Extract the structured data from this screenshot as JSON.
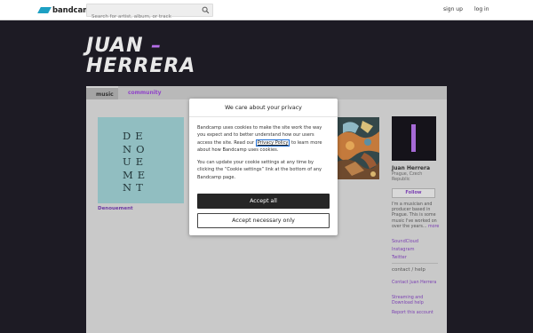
{
  "header": {
    "brand": "bandcamp",
    "search_placeholder": "Search for artist, album, or track",
    "signup_label": "sign up",
    "login_label": "log in",
    "brand_color": "#1da0c3"
  },
  "artist": {
    "name_line1": "JUAN",
    "name_dash": "–",
    "name_line2": "HERRERA",
    "accent_color": "#b56ee8"
  },
  "tabs": [
    {
      "label": "music",
      "active": true
    },
    {
      "label": "community",
      "active": false
    }
  ],
  "albums": [
    {
      "title": "Denouement",
      "cover_text": "DE\nNO\nUE\nME\nNT"
    }
  ],
  "sidebar": {
    "name": "Juan Herrera",
    "location": "Prague, Czech Republic",
    "follow_label": "Follow",
    "bio": "I'm a musician and producer based in Prague. This is some music I've worked on over the years...",
    "bio_more": "more",
    "links": [
      "SoundCloud",
      "Instagram",
      "Twitter"
    ],
    "contact_heading": "contact / help",
    "contact_links": [
      "Contact Juan Herrera",
      "Streaming and Download help",
      "Report this account"
    ]
  },
  "cookie_dialog": {
    "title": "We care about your privacy",
    "body_part1": "Bandcamp uses cookies to make the site work the way you expect and to better understand how our users access the site. Read our ",
    "policy_link": "Privacy Policy",
    "body_part2": " to learn more about how Bandcamp uses cookies.",
    "body2": "You can update your cookie settings at any time by clicking the “Cookie settings” link at the bottom of any Bandcamp page.",
    "accept_all_label": "Accept all",
    "accept_necessary_label": "Accept necessary only"
  }
}
